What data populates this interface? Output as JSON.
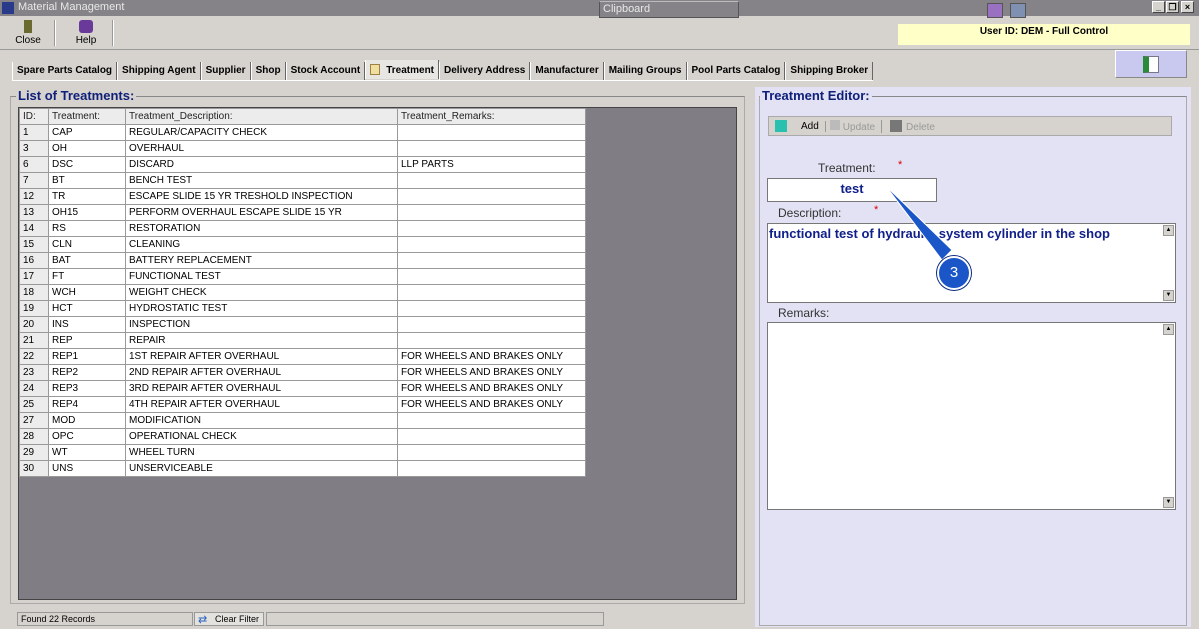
{
  "window": {
    "title": "Material Management",
    "clipboard": "Clipboard"
  },
  "toolbar": {
    "close": "Close",
    "help": "Help"
  },
  "user": "User ID: DEM - Full Control",
  "tabs": [
    "Spare Parts Catalog",
    "Shipping Agent",
    "Supplier",
    "Shop",
    "Stock Account",
    "Treatment",
    "Delivery Address",
    "Manufacturer",
    "Mailing Groups",
    "Pool Parts Catalog",
    "Shipping Broker"
  ],
  "list": {
    "title": "List of Treatments:",
    "columns": [
      "ID:",
      "Treatment:",
      "Treatment_Description:",
      "Treatment_Remarks:"
    ],
    "rows": [
      [
        "1",
        "CAP",
        "REGULAR/CAPACITY CHECK",
        ""
      ],
      [
        "3",
        "OH",
        "OVERHAUL",
        ""
      ],
      [
        "6",
        "DSC",
        "DISCARD",
        "LLP PARTS"
      ],
      [
        "7",
        "BT",
        "BENCH TEST",
        ""
      ],
      [
        "12",
        "TR",
        "ESCAPE SLIDE 15 YR TRESHOLD INSPECTION",
        ""
      ],
      [
        "13",
        "OH15",
        "PERFORM OVERHAUL ESCAPE SLIDE 15 YR",
        ""
      ],
      [
        "14",
        "RS",
        "RESTORATION",
        ""
      ],
      [
        "15",
        "CLN",
        "CLEANING",
        ""
      ],
      [
        "16",
        "BAT",
        "BATTERY REPLACEMENT",
        ""
      ],
      [
        "17",
        "FT",
        "FUNCTIONAL TEST",
        ""
      ],
      [
        "18",
        "WCH",
        "WEIGHT CHECK",
        ""
      ],
      [
        "19",
        "HCT",
        "HYDROSTATIC TEST",
        ""
      ],
      [
        "20",
        "INS",
        "INSPECTION",
        ""
      ],
      [
        "21",
        "REP",
        "REPAIR",
        ""
      ],
      [
        "22",
        "REP1",
        "1ST REPAIR AFTER OVERHAUL",
        "FOR WHEELS AND BRAKES ONLY"
      ],
      [
        "23",
        "REP2",
        "2ND REPAIR AFTER OVERHAUL",
        "FOR WHEELS AND BRAKES ONLY"
      ],
      [
        "24",
        "REP3",
        "3RD REPAIR AFTER OVERHAUL",
        "FOR WHEELS AND BRAKES ONLY"
      ],
      [
        "25",
        "REP4",
        "4TH REPAIR AFTER OVERHAUL",
        "FOR WHEELS AND BRAKES ONLY"
      ],
      [
        "27",
        "MOD",
        "MODIFICATION",
        ""
      ],
      [
        "28",
        "OPC",
        "OPERATIONAL CHECK",
        ""
      ],
      [
        "29",
        "WT",
        "WHEEL TURN",
        ""
      ],
      [
        "30",
        "UNS",
        "UNSERVICEABLE",
        ""
      ]
    ]
  },
  "status": {
    "found": "Found 22 Records",
    "clear_filter": "Clear Filter"
  },
  "editor": {
    "title": "Treatment Editor:",
    "add": "Add",
    "update": "Update",
    "delete": "Delete",
    "treatment_label": "Treatment:",
    "treatment_value": "test",
    "description_label": "Description:",
    "description_value": "functional test of hydraulic system cylinder in the shop",
    "remarks_label": "Remarks:",
    "remarks_value": "",
    "required": "*"
  },
  "annotation": "3"
}
